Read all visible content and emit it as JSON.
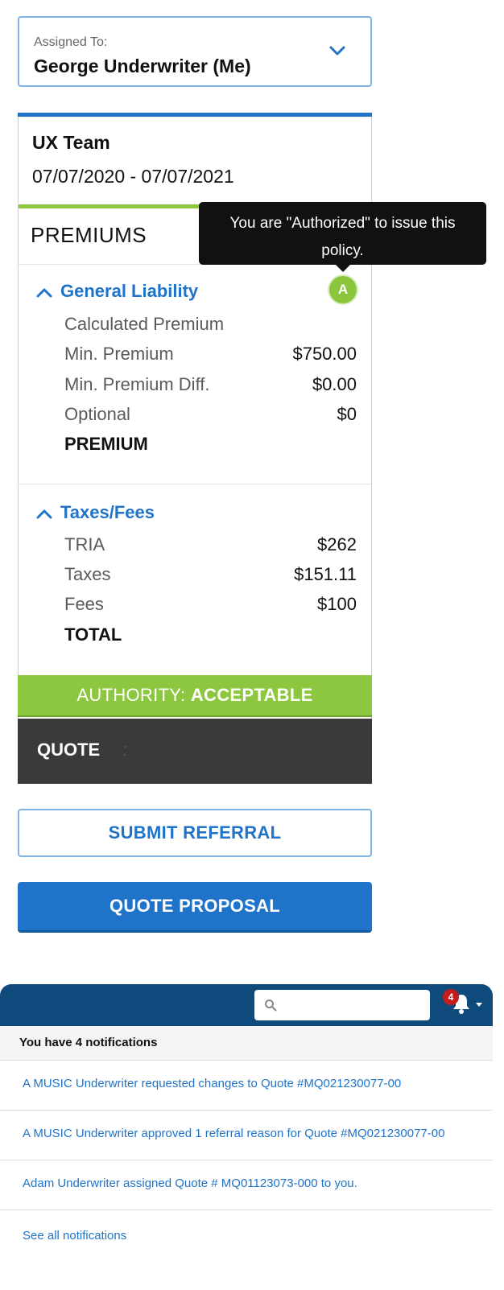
{
  "assigned": {
    "label": "Assigned To:",
    "value": "George Underwriter (Me)",
    "icon": "chevron-down-icon"
  },
  "policy": {
    "team": "UX Team",
    "dates": "07/07/2020 - 07/07/2021"
  },
  "premiums": {
    "title": "PREMIUMS",
    "tooltip": "You are \"Authorized\" to issue this policy.",
    "authorization_badge": "A",
    "general_liability": {
      "heading": "General Liability",
      "rows": [
        {
          "label": "Calculated Premium",
          "value": ""
        },
        {
          "label": "Min. Premium",
          "value": "$750.00"
        },
        {
          "label": "Min. Premium Diff.",
          "value": "$0.00"
        },
        {
          "label": "Optional",
          "value": "$0"
        },
        {
          "label": "PREMIUM",
          "value": ""
        }
      ]
    },
    "taxes_fees": {
      "heading": "Taxes/Fees",
      "rows": [
        {
          "label": "TRIA",
          "value": "$262"
        },
        {
          "label": "Taxes",
          "value": "$151.11"
        },
        {
          "label": "Fees",
          "value": "$100"
        },
        {
          "label": "TOTAL",
          "value": ""
        }
      ]
    },
    "authority": {
      "prefix": "AUTHORITY: ",
      "status": "ACCEPTABLE"
    },
    "quote": {
      "label": "QUOTE",
      "separator": ":"
    }
  },
  "buttons": {
    "submit_referral": "SUBMIT REFERRAL",
    "quote_proposal": "QUOTE PROPOSAL"
  },
  "notifications": {
    "badge_count": "4",
    "search_placeholder": "",
    "summary": "You have 4 notifications",
    "items": [
      "A MUSIC Underwriter requested changes to Quote #MQ021230077-00",
      "A MUSIC Underwriter approved 1 referral reason for Quote #MQ021230077-00",
      "Adam Underwriter assigned Quote # MQ01123073-000 to you."
    ],
    "see_all": "See all notifications"
  },
  "colors": {
    "accent_blue": "#1f73c9",
    "success_green": "#8cc63f",
    "header_navy": "#0f4a7c",
    "dark_bar": "#3a3a3a"
  }
}
